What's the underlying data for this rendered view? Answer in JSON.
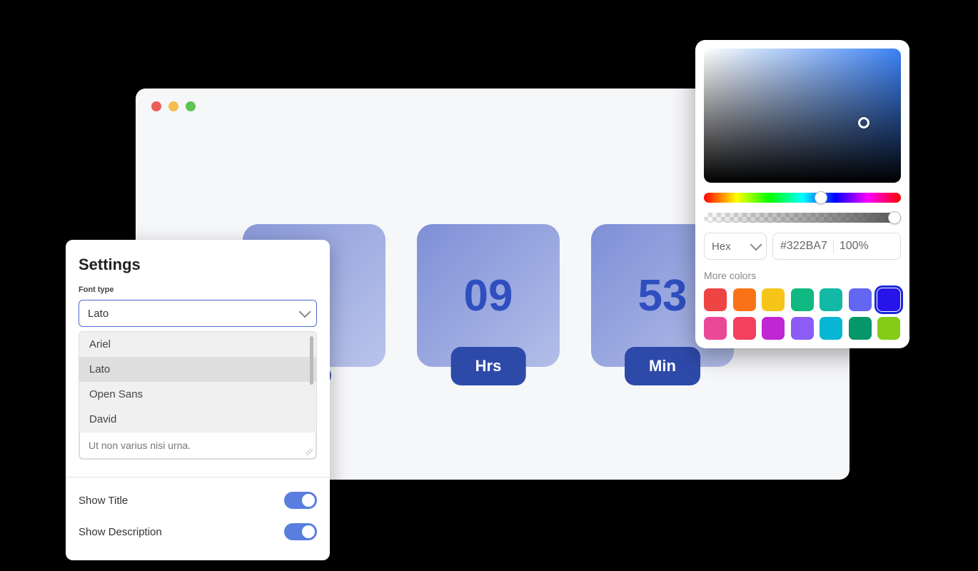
{
  "timer": {
    "tiles": [
      {
        "value": "",
        "label": ""
      },
      {
        "value": "09",
        "label": "Hrs"
      },
      {
        "value": "53",
        "label": "Min"
      }
    ]
  },
  "settings": {
    "title": "Settings",
    "font_label": "Font type",
    "font_selected": "Lato",
    "font_options": [
      "Ariel",
      "Lato",
      "Open Sans",
      "David"
    ],
    "description_text": "Ut non varius nisi urna.",
    "show_title_label": "Show Title",
    "show_description_label": "Show Description",
    "show_title": true,
    "show_description": true
  },
  "colorpicker": {
    "format": "Hex",
    "hex": "#322BA7",
    "opacity": "100%",
    "more_label": "More colors",
    "swatches": [
      "#ef4444",
      "#f97316",
      "#f5c518",
      "#10b981",
      "#14b8a6",
      "#6366f1",
      "#2614e8",
      "#ec4899",
      "#f43f5e",
      "#c026d3",
      "#8b5cf6",
      "#06b6d4",
      "#059669",
      "#84cc16"
    ],
    "selected_swatch_index": 6
  }
}
